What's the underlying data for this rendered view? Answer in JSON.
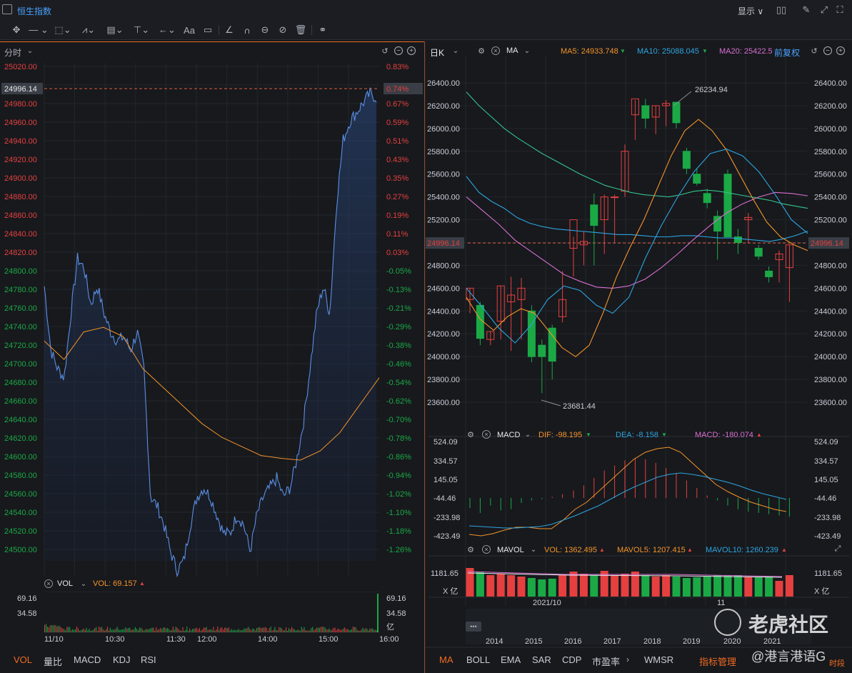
{
  "window": {
    "title": "恒生指数",
    "display_label": "显示 ∨"
  },
  "toolbar": {
    "tools": [
      "move-icon",
      "line-icon",
      "rect-icon",
      "polyline-icon",
      "fib-icon",
      "measure-icon",
      "arrow-icon",
      "text-icon",
      "note-icon",
      "ruler-icon",
      "magnet-icon",
      "eye-icon",
      "hide-icon",
      "trash-icon",
      "link-icon"
    ],
    "text_tool": "Aa"
  },
  "left": {
    "panel_title": "分时",
    "current_price": "24996.14",
    "current_pct": "0.74%",
    "price_ticks": [
      "25020.00",
      "24996.14",
      "24980.00",
      "24960.00",
      "24940.00",
      "24920.00",
      "24900.00",
      "24880.00",
      "24860.00",
      "24840.00",
      "24820.00",
      "24800.00",
      "24780.00",
      "24760.00",
      "24740.00",
      "24720.00",
      "24700.00",
      "24680.00",
      "24660.00",
      "24640.00",
      "24620.00",
      "24600.00",
      "24580.00",
      "24560.00",
      "24540.00",
      "24520.00",
      "24500.00"
    ],
    "pct_ticks": [
      "0.83%",
      "0.74%",
      "0.67%",
      "0.59%",
      "0.51%",
      "0.43%",
      "0.35%",
      "0.27%",
      "0.19%",
      "0.11%",
      "0.03%",
      "-0.05%",
      "-0.13%",
      "-0.21%",
      "-0.29%",
      "-0.38%",
      "-0.46%",
      "-0.54%",
      "-0.62%",
      "-0.70%",
      "-0.78%",
      "-0.86%",
      "-0.94%",
      "-1.02%",
      "-1.10%",
      "-1.18%",
      "-1.26%"
    ],
    "vol_label": "VOL",
    "vol_value": "VOL: 69.157",
    "vol_max": "69.16",
    "vol_mid": "34.58",
    "vol_unit": "亿",
    "time_ticks": [
      "11/10",
      "10:30",
      "11:30",
      "12:00",
      "14:00",
      "15:00",
      "16:00"
    ],
    "bottom_tabs": [
      "VOL",
      "量比",
      "MACD",
      "KDJ",
      "RSI"
    ]
  },
  "right": {
    "period": "日K",
    "indicator": "MA",
    "ma5": "MA5: 24933.748",
    "ma10": "MA10: 25088.045",
    "ma20": "MA20: 25422.5",
    "adjust": "前复权",
    "current_price": "24996.14",
    "price_ticks": [
      "26400.00",
      "26200.00",
      "26000.00",
      "25800.00",
      "25600.00",
      "25400.00",
      "25200.00",
      "25000.00",
      "24800.00",
      "24600.00",
      "24400.00",
      "24200.00",
      "24000.00",
      "23800.00",
      "23600.00"
    ],
    "high_label": "26234.94",
    "low_label": "23681.44",
    "macd_label": "MACD",
    "dif": "DIF: -98.195",
    "dea": "DEA: -8.158",
    "macd_val": "MACD: -180.074",
    "macd_ticks": [
      "524.09",
      "334.57",
      "145.05",
      "-44.46",
      "-233.98",
      "-423.49"
    ],
    "mavol_label": "MAVOL",
    "vol": "VOL: 1362.495",
    "mavol5": "MAVOL5: 1207.415",
    "mavol10": "MAVOL10: 1260.239",
    "vol_tick": "1181.65",
    "vol_unit": "X 亿",
    "date_ticks": [
      "2021/10",
      "11"
    ],
    "year_ticks": [
      "2014",
      "2015",
      "2016",
      "2017",
      "2018",
      "2019",
      "2020",
      "2021"
    ],
    "bottom_tabs": [
      "MA",
      "BOLL",
      "EMA",
      "SAR",
      "CDP",
      "市盈率",
      "WMSR",
      "指标管理"
    ],
    "watermark": "老虎社区",
    "watermark_user": "@港言港语G",
    "corner_tag": "时段"
  },
  "colors": {
    "up": "#e5403f",
    "down": "#1ba946",
    "ma5": "#f5932a",
    "ma10": "#2ea4e0",
    "ma20": "#d86fd0",
    "ma60": "#36c38a",
    "line": "#5b8fe6",
    "accent": "#f26b21"
  },
  "chart_data": [
    {
      "type": "line",
      "title": "分时",
      "ylim": [
        24490,
        25030
      ],
      "series": [
        {
          "name": "price",
          "values": [
            24790,
            24720,
            24700,
            24690,
            24760,
            24820,
            24810,
            24770,
            24790,
            24760,
            24740,
            24730,
            24735,
            24720,
            24740,
            24700,
            24560,
            24550,
            24530,
            24500,
            24480,
            24490,
            24530,
            24560,
            24570,
            24560,
            24540,
            24520,
            24520,
            24540,
            24530,
            24500,
            24540,
            24560,
            24570,
            24580,
            24560,
            24570,
            24600,
            24640,
            24700,
            24760,
            24790,
            24760,
            24880,
            24950,
            24970,
            24980,
            24990,
            25000,
            24996
          ]
        },
        {
          "name": "avg",
          "values": [
            24730,
            24710,
            24740,
            24745,
            24735,
            24700,
            24680,
            24660,
            24640,
            24625,
            24615,
            24605,
            24602,
            24600,
            24610,
            24630,
            24660,
            24690
          ]
        }
      ]
    },
    {
      "type": "candlestick",
      "title": "日K",
      "ylim": [
        23550,
        26450
      ],
      "ohlc": [
        [
          24500,
          24600,
          24380,
          24600
        ],
        [
          24450,
          24480,
          24100,
          24160
        ],
        [
          24150,
          24220,
          24100,
          24220
        ],
        [
          24310,
          24620,
          24150,
          24620
        ],
        [
          24480,
          24700,
          24050,
          24540
        ],
        [
          24500,
          24690,
          24150,
          24600
        ],
        [
          24400,
          24450,
          23950,
          24000
        ],
        [
          24100,
          24150,
          23680,
          24000
        ],
        [
          24250,
          24280,
          23800,
          23960
        ],
        [
          24350,
          24750,
          24300,
          24500
        ],
        [
          24950,
          25050,
          24700,
          25200
        ],
        [
          24980,
          25100,
          24800,
          25010
        ],
        [
          25330,
          25430,
          24800,
          25150
        ],
        [
          25200,
          25420,
          24900,
          25400
        ],
        [
          25400,
          25420,
          25000,
          25400
        ],
        [
          25450,
          25860,
          25400,
          25800
        ],
        [
          26120,
          26250,
          25900,
          26260
        ],
        [
          26200,
          26260,
          26000,
          26090
        ],
        [
          26100,
          26200,
          25950,
          26200
        ],
        [
          26200,
          26250,
          26020,
          26220
        ],
        [
          26230,
          26234,
          26000,
          26050
        ],
        [
          25800,
          25830,
          25600,
          25650
        ],
        [
          25600,
          25650,
          25500,
          25520
        ],
        [
          25430,
          25470,
          25300,
          25350
        ],
        [
          25230,
          25280,
          24850,
          25100
        ],
        [
          25600,
          25640,
          25200,
          25050
        ],
        [
          25050,
          25120,
          24900,
          25000
        ],
        [
          25200,
          25260,
          25000,
          25220
        ],
        [
          24950,
          24980,
          24850,
          24880
        ],
        [
          24750,
          24790,
          24650,
          24700
        ],
        [
          24850,
          24930,
          24650,
          24900
        ],
        [
          24780,
          24980,
          24480,
          24980
        ]
      ]
    },
    {
      "type": "bar",
      "title": "MACD",
      "ylim": [
        -423.49,
        524.09
      ]
    },
    {
      "type": "bar",
      "title": "MAVOL",
      "ylim": [
        0,
        1400
      ]
    }
  ]
}
